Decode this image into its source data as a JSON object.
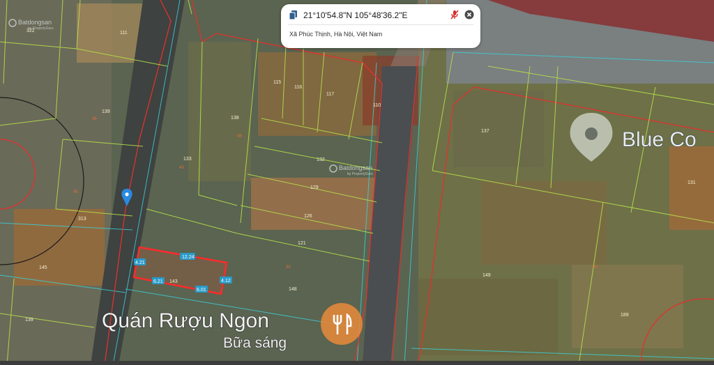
{
  "info_card": {
    "coordinates": "21°10'54.8\"N 105°48'36.2\"E",
    "address": "Xã Phúc Thịnh, Hà Nội, Việt Nam"
  },
  "watermark": {
    "brand": "Batdongsan",
    "sub": "by PropertyGuru"
  },
  "selected_parcel": {
    "number": "143",
    "dimensions": {
      "top": "12.24",
      "left": "4.21",
      "right": "4.12",
      "bottom_left": "6.21",
      "bottom_right": "6.01"
    }
  },
  "plot_numbers": [
    "322",
    "111",
    "139",
    "133",
    "138",
    "115",
    "116",
    "117",
    "110",
    "132",
    "129",
    "126",
    "121",
    "313",
    "145",
    "148",
    "139",
    "137",
    "131",
    "149",
    "189",
    "30",
    "36",
    "43",
    "45",
    "46"
  ],
  "pois": [
    {
      "name": "Quán Rượu Ngon",
      "subtitle": "Bữa sáng"
    },
    {
      "name": "Blue Co"
    }
  ],
  "colors": {
    "parcel_line": "#b5e04a",
    "boundary": "#e0322e",
    "selected": "#ff2a2a",
    "road_line": "#3ad0d8",
    "poi_orange": "#e98a3a"
  },
  "icons": [
    "copy-icon",
    "mic-off-icon",
    "close-icon",
    "location-pin-icon",
    "restaurant-icon",
    "place-icon"
  ]
}
